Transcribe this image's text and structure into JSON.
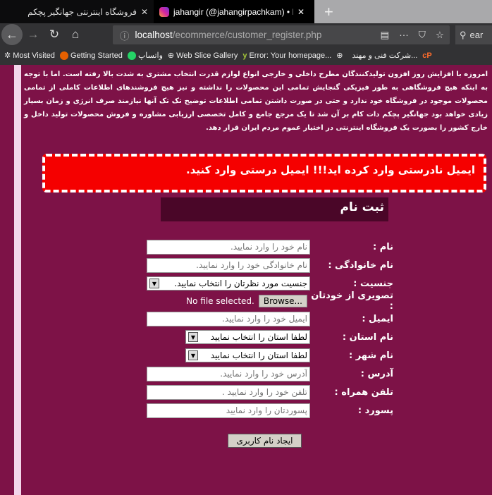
{
  "browser": {
    "tabs": [
      {
        "title": "فروشگاه اینترنتی جهانگیر پچکم"
      },
      {
        "title": "jahangir (@jahangirpachkam) • Ins"
      }
    ],
    "url_host": "localhost",
    "url_path": "/ecommerce/customer_register.php",
    "search_text": "ear",
    "bookmarks": [
      "Most Visited",
      "Getting Started",
      "واتساپ",
      "Web Slice Gallery",
      "Error: Your homepage...",
      "شرکت فنی و مهند..."
    ]
  },
  "intro": "امروزه با افزایش روز افزون تولیدکنندگان مطرح داخلی و خارجی انواع لوازم قدرت انتخاب مشتری به شدت بالا رفته است. اما با توجه به اینکه هیچ فروشگاهی به طور فیزیکی گنجایش تمامی این محصولات را نداشته و نیز هیچ فروشندهای اطلاعات کاملی از تمامی محصولات موجود در فروشگاه خود ندارد و حتی در صورت داشتن تمامی اطلاعات توضیح تک تک آنها نیازمند صرف انرژی و زمان بسیار زیادی خواهد بود جهانگیر پچکم دات کام بر آن شد تا یک مرجع جامع و کامل تخصصی ارزیابی مشاوره و فروش محصولات تولید داخل و خارج کشور را بصورت یک فروشگاه اینترنتی در اختیار عموم مردم ایران قرار دهد.",
  "error": "ایمیل نادرستی وارد کرده اید!!! ایمیل درستی وارد کنید.",
  "form": {
    "title": "ثبت نام",
    "name": {
      "label": "نام :",
      "placeholder": "نام خود را وارد نمایید."
    },
    "family": {
      "label": "نام خانوادگی :",
      "placeholder": "نام خانوادگی خود را وارد نمایید."
    },
    "gender": {
      "label": "جنسیت :",
      "value": "جنسیت مورد نظرتان را انتخاب نمایید."
    },
    "photo": {
      "label": "تصویری از خودتان :",
      "browse": "Browse...",
      "status": "No file selected."
    },
    "email": {
      "label": "ایمیل :",
      "placeholder": "ایمیل خود را وارد نمایید."
    },
    "province": {
      "label": "نام استان :",
      "value": "لطفا استان را انتخاب نمایید"
    },
    "city": {
      "label": "نام شهر :",
      "value": "لطفا استان را انتخاب نمایید"
    },
    "address": {
      "label": "آدرس :",
      "placeholder": "آدرس خود را وارد نمایید."
    },
    "phone": {
      "label": "تلفن همراه :",
      "placeholder": "تلفن خود را وارد نمایید ."
    },
    "password": {
      "label": "پسورد :",
      "placeholder": "پسوردتان را وارد نمایید"
    },
    "submit": "ایجاد نام کاربری"
  }
}
